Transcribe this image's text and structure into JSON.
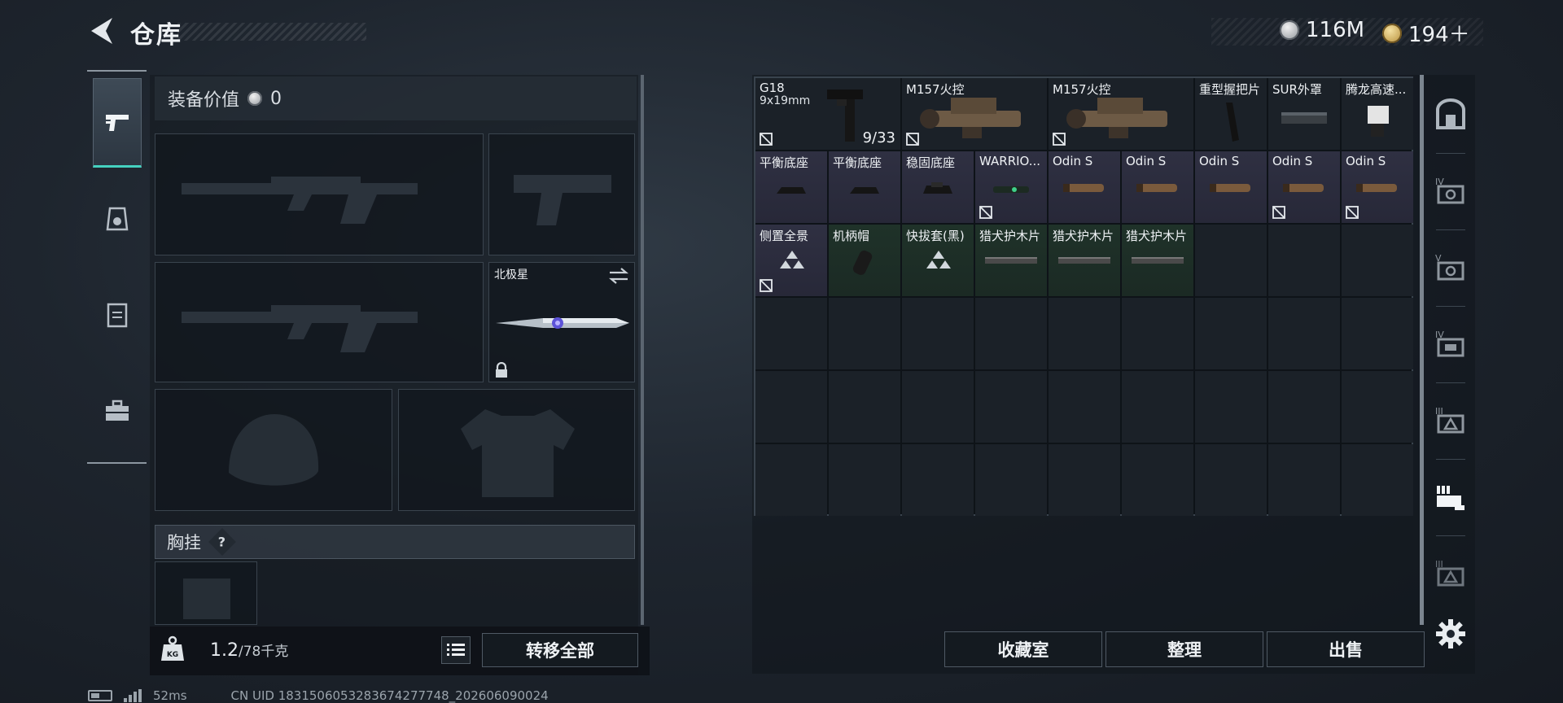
{
  "header": {
    "title": "仓库"
  },
  "currencies": {
    "silver": "116M",
    "gold": "194＋"
  },
  "categories": [
    {
      "name": "weapons",
      "icon": "pistol-icon",
      "active": true
    },
    {
      "name": "armor",
      "icon": "helmet-icon",
      "active": false
    },
    {
      "name": "vest",
      "icon": "vest-icon",
      "active": false
    },
    {
      "name": "items",
      "icon": "toolbox-icon",
      "active": false
    }
  ],
  "equipment": {
    "value_label": "装备价值",
    "value": "0",
    "melee_name": "北极星",
    "chest_label": "胸挂",
    "help": "?",
    "weight_current": "1.2",
    "weight_max": "/78千克",
    "transfer_all": "转移全部"
  },
  "storage": {
    "row1": [
      {
        "name": "G18",
        "sub": "9x19mm",
        "count": "9/33",
        "rarity": "dark",
        "locked": true,
        "span": 2
      },
      {
        "name": "M157火控",
        "rarity": "dark",
        "locked": true,
        "span": 2
      },
      {
        "name": "M157火控",
        "rarity": "dark",
        "locked": true,
        "span": 2
      },
      {
        "name": "重型握把片",
        "rarity": "dark",
        "locked": false,
        "span": 1
      },
      {
        "name": "SUR外罩",
        "rarity": "dark",
        "locked": false,
        "span": 1
      },
      {
        "name": "腾龙高速...",
        "rarity": "dark",
        "locked": false,
        "span": 1
      }
    ],
    "row2": [
      {
        "name": "平衡底座",
        "rarity": "purple",
        "locked": false
      },
      {
        "name": "平衡底座",
        "rarity": "purple",
        "locked": false
      },
      {
        "name": "稳固底座",
        "rarity": "purple",
        "locked": false
      },
      {
        "name": "WARRIO...",
        "rarity": "purple",
        "locked": true
      },
      {
        "name": "Odin S",
        "rarity": "purple",
        "locked": false
      },
      {
        "name": "Odin S",
        "rarity": "purple",
        "locked": false
      },
      {
        "name": "Odin S",
        "rarity": "purple",
        "locked": false
      },
      {
        "name": "Odin S",
        "rarity": "purple",
        "locked": true
      },
      {
        "name": "Odin S",
        "rarity": "purple",
        "locked": true
      }
    ],
    "row3": [
      {
        "name": "侧置全景",
        "rarity": "purple",
        "locked": true
      },
      {
        "name": "机柄帽",
        "rarity": "green",
        "locked": false
      },
      {
        "name": "快拔套(黑)",
        "rarity": "green",
        "locked": false
      },
      {
        "name": "猎犬护木片",
        "rarity": "green",
        "locked": false
      },
      {
        "name": "猎犬护木片",
        "rarity": "green",
        "locked": false
      },
      {
        "name": "猎犬护木片",
        "rarity": "green",
        "locked": false
      }
    ],
    "buttons": {
      "collection": "收藏室",
      "sort": "整理",
      "sell": "出售"
    }
  },
  "side_tabs": [
    {
      "icon": "safe-icon"
    },
    {
      "icon": "storage-iv-icon"
    },
    {
      "icon": "storage-v-icon"
    },
    {
      "icon": "storage-iv-alt-icon"
    },
    {
      "icon": "storage-iii-icon"
    },
    {
      "icon": "storage-ext-icon"
    },
    {
      "icon": "storage-iii-alt-icon"
    },
    {
      "icon": "settings-gear-icon"
    }
  ],
  "status": {
    "ping": "52ms",
    "uid": "CN UID 1831506053283674277748_202606090024"
  },
  "colors": {
    "accent": "#45d1c0",
    "purple_rarity": "#2f3042",
    "green_rarity": "#1f3229"
  }
}
